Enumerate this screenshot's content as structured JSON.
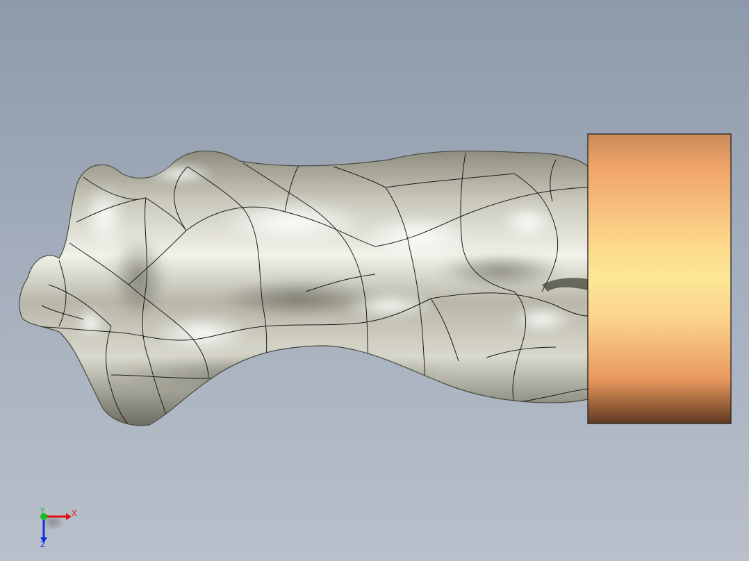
{
  "view": {
    "background_top": "#8d9aab",
    "background_bottom": "#b9c0cb"
  },
  "model": {
    "body_color": "#d8d7cc",
    "edge_color": "#1a1a1a",
    "cylinder_color_light": "#fde797",
    "cylinder_color_mid": "#f3a868",
    "cylinder_color_dark": "#5e3a22"
  },
  "triad": {
    "x_label": "X",
    "y_label": "Y",
    "z_label": "Z",
    "x_color": "#e01010",
    "y_color": "#10c020",
    "z_color": "#1030e0"
  }
}
